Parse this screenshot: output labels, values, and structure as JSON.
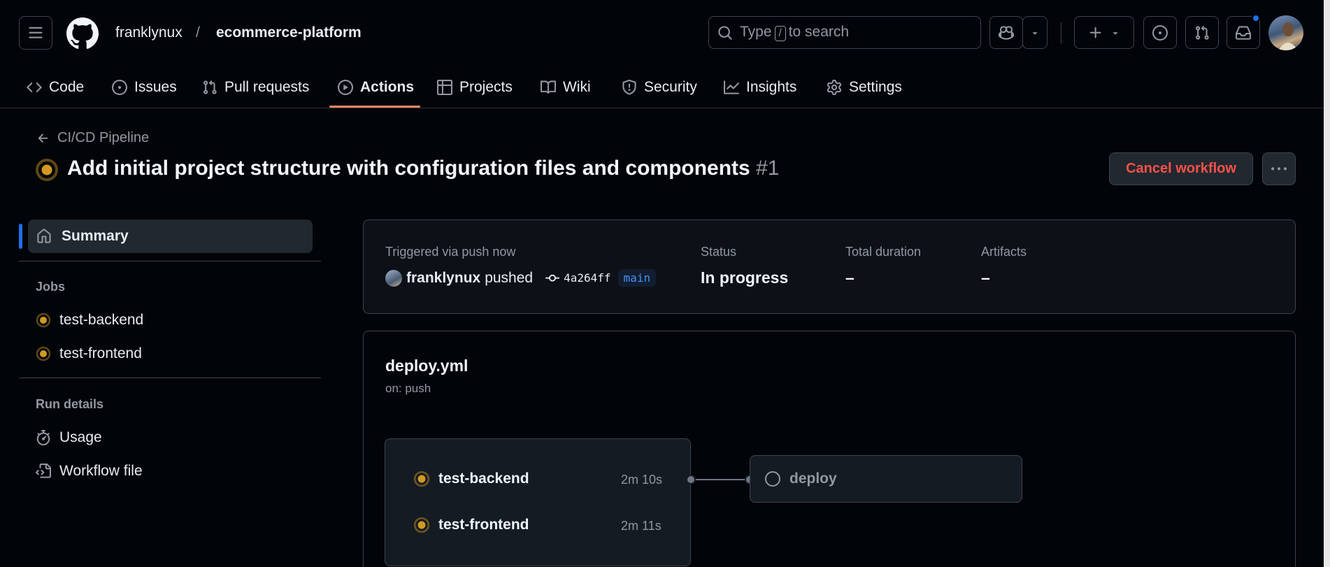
{
  "header": {
    "owner": "franklynux",
    "separator": "/",
    "repo": "ecommerce-platform",
    "search_prefix": "Type",
    "search_key": "/",
    "search_suffix": "to search"
  },
  "nav": {
    "items": [
      {
        "label": "Code",
        "icon": "code-icon"
      },
      {
        "label": "Issues",
        "icon": "issue-icon"
      },
      {
        "label": "Pull requests",
        "icon": "pull-request-icon"
      },
      {
        "label": "Actions",
        "icon": "play-icon"
      },
      {
        "label": "Projects",
        "icon": "table-icon"
      },
      {
        "label": "Wiki",
        "icon": "book-icon"
      },
      {
        "label": "Security",
        "icon": "shield-icon"
      },
      {
        "label": "Insights",
        "icon": "graph-icon"
      },
      {
        "label": "Settings",
        "icon": "gear-icon"
      }
    ],
    "active": "Actions"
  },
  "run": {
    "workflow_name": "CI/CD Pipeline",
    "title": "Add initial project structure with configuration files and components",
    "number": "#1",
    "cancel_label": "Cancel workflow"
  },
  "sidebar": {
    "summary_label": "Summary",
    "jobs_heading": "Jobs",
    "jobs": [
      "test-backend",
      "test-frontend"
    ],
    "run_details_heading": "Run details",
    "run_details": [
      {
        "label": "Usage",
        "icon": "stopwatch-icon"
      },
      {
        "label": "Workflow file",
        "icon": "file-code-icon"
      }
    ]
  },
  "summary": {
    "trigger_label": "Triggered via push now",
    "actor": "franklynux",
    "action": "pushed",
    "commit": "4a264ff",
    "branch": "main",
    "status_label": "Status",
    "status_value": "In progress",
    "duration_label": "Total duration",
    "duration_value": "–",
    "artifacts_label": "Artifacts",
    "artifacts_value": "–"
  },
  "graph": {
    "file": "deploy.yml",
    "trigger": "on: push",
    "jobs": [
      {
        "name": "test-backend",
        "duration": "2m 10s",
        "status": "in_progress"
      },
      {
        "name": "test-frontend",
        "duration": "2m 11s",
        "status": "in_progress"
      }
    ],
    "next_job": {
      "name": "deploy",
      "status": "queued"
    }
  },
  "colors": {
    "in_progress": "#d29922",
    "accent": "#1f6feb",
    "danger": "#f85149",
    "nav_underline": "#f78166"
  }
}
